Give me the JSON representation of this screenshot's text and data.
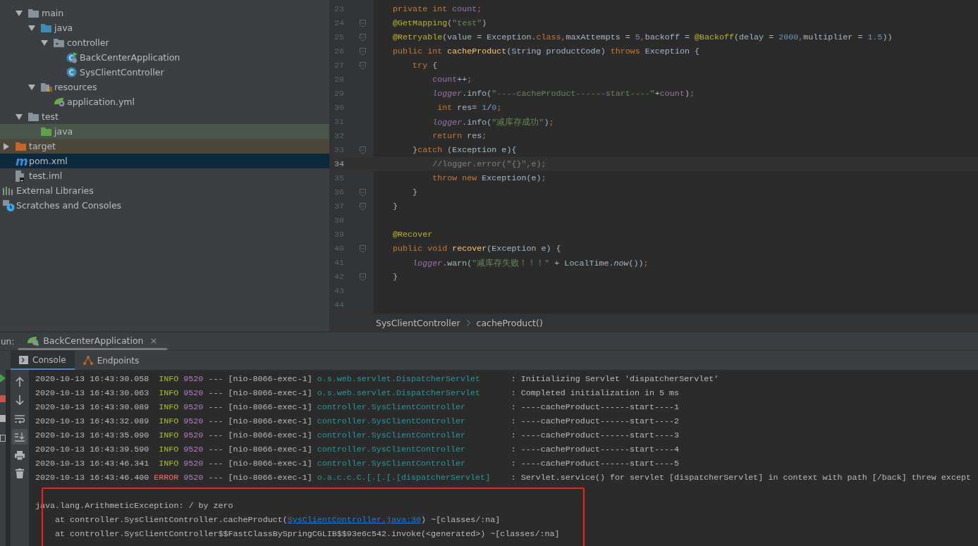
{
  "project": {
    "tree": [
      {
        "name": "main",
        "kind": "folder",
        "expanded": true,
        "selected": false,
        "children": [
          {
            "name": "java",
            "kind": "source-folder",
            "expanded": true,
            "selected": false,
            "children": [
              {
                "name": "controller",
                "kind": "package",
                "expanded": true,
                "selected": false,
                "children": [
                  {
                    "name": "BackCenterApplication",
                    "kind": "spring-class",
                    "selected": false
                  },
                  {
                    "name": "SysClientController",
                    "kind": "class",
                    "selected": false
                  }
                ]
              }
            ]
          },
          {
            "name": "resources",
            "kind": "resources-folder",
            "expanded": true,
            "selected": false,
            "children": [
              {
                "name": "application.yml",
                "kind": "spring-config",
                "selected": false
              }
            ]
          }
        ]
      },
      {
        "name": "test",
        "kind": "folder",
        "expanded": true,
        "selected": false,
        "children": [
          {
            "name": "java",
            "kind": "test-folder",
            "selected": false,
            "color": "#49544a"
          }
        ]
      }
    ],
    "root_items": [
      {
        "name": "target",
        "kind": "excluded-folder",
        "expanded": false,
        "selected": false,
        "color": "#4b473b"
      },
      {
        "name": "pom.xml",
        "kind": "maven",
        "icon_text": "m",
        "selected": true
      },
      {
        "name": "test.iml",
        "kind": "module-file",
        "selected": false
      }
    ],
    "extra": [
      {
        "name": "External Libraries",
        "kind": "libraries"
      },
      {
        "name": "Scratches and Consoles",
        "kind": "scratches"
      }
    ]
  },
  "editor": {
    "lines": [
      {
        "no": "23",
        "fold": false,
        "current": false,
        "segs": [
          {
            "kind": "kw",
            "text": "    private int "
          },
          {
            "kind": "fld",
            "text": "count"
          },
          {
            "kind": "kw",
            "text": ";"
          }
        ]
      },
      {
        "no": "24",
        "fold": true,
        "current": false,
        "segs": [
          {
            "kind": "ann",
            "text": "    @GetMapping"
          },
          {
            "kind": "txt",
            "text": "("
          },
          {
            "kind": "str",
            "text": "\"test\""
          },
          {
            "kind": "txt",
            "text": ")"
          }
        ]
      },
      {
        "no": "25",
        "fold": true,
        "current": false,
        "segs": [
          {
            "kind": "ann",
            "text": "    @Retryable"
          },
          {
            "kind": "txt",
            "text": "(value = Exception."
          },
          {
            "kind": "kw",
            "text": "class,"
          },
          {
            "kind": "txt",
            "text": "maxAttempts = "
          },
          {
            "kind": "num",
            "text": "5"
          },
          {
            "kind": "kw",
            "text": ","
          },
          {
            "kind": "txt",
            "text": "backoff = "
          },
          {
            "kind": "ann",
            "text": "@Backoff"
          },
          {
            "kind": "txt",
            "text": "(delay = "
          },
          {
            "kind": "num",
            "text": "2000"
          },
          {
            "kind": "kw",
            "text": ","
          },
          {
            "kind": "txt",
            "text": "multiplier = "
          },
          {
            "kind": "num",
            "text": "1.5"
          },
          {
            "kind": "txt",
            "text": "))"
          }
        ]
      },
      {
        "no": "26",
        "fold": true,
        "current": false,
        "segs": [
          {
            "kind": "kw",
            "text": "    public int "
          },
          {
            "kind": "fn",
            "text": "cacheProduct"
          },
          {
            "kind": "txt",
            "text": "(String productCode) "
          },
          {
            "kind": "kw",
            "text": "throws "
          },
          {
            "kind": "txt",
            "text": "Exception {"
          }
        ]
      },
      {
        "no": "27",
        "fold": true,
        "current": false,
        "segs": [
          {
            "kind": "kw",
            "text": "        try "
          },
          {
            "kind": "txt",
            "text": "{"
          }
        ]
      },
      {
        "no": "28",
        "fold": false,
        "current": false,
        "segs": [
          {
            "kind": "fld",
            "text": "            count"
          },
          {
            "kind": "txt",
            "text": "++"
          },
          {
            "kind": "kw",
            "text": ";"
          }
        ]
      },
      {
        "no": "29",
        "fold": false,
        "current": false,
        "segs": [
          {
            "kind": "fldi",
            "text": "            logger"
          },
          {
            "kind": "txt",
            "text": ".info("
          },
          {
            "kind": "str",
            "text": "\"----cacheProduct------start----\""
          },
          {
            "kind": "txt",
            "text": "+"
          },
          {
            "kind": "fld",
            "text": "count"
          },
          {
            "kind": "txt",
            "text": ")"
          },
          {
            "kind": "kw",
            "text": ";"
          }
        ]
      },
      {
        "no": "30",
        "fold": false,
        "current": false,
        "segs": [
          {
            "kind": "kw",
            "text": "             int "
          },
          {
            "kind": "txt",
            "text": "res= "
          },
          {
            "kind": "num",
            "text": "1"
          },
          {
            "kind": "txt",
            "text": "/"
          },
          {
            "kind": "num",
            "text": "0"
          },
          {
            "kind": "kw",
            "text": ";"
          }
        ]
      },
      {
        "no": "31",
        "fold": false,
        "current": false,
        "segs": [
          {
            "kind": "fldi",
            "text": "            logger"
          },
          {
            "kind": "txt",
            "text": ".info("
          },
          {
            "kind": "str",
            "text": "\"减库存成功\""
          },
          {
            "kind": "txt",
            "text": ")"
          },
          {
            "kind": "kw",
            "text": ";"
          }
        ]
      },
      {
        "no": "32",
        "fold": false,
        "current": false,
        "segs": [
          {
            "kind": "kw",
            "text": "            return "
          },
          {
            "kind": "txt",
            "text": "res"
          },
          {
            "kind": "kw",
            "text": ";"
          }
        ]
      },
      {
        "no": "33",
        "fold": true,
        "current": false,
        "segs": [
          {
            "kind": "txt",
            "text": "        }"
          },
          {
            "kind": "kw",
            "text": "catch "
          },
          {
            "kind": "txt",
            "text": "(Exception e){"
          }
        ]
      },
      {
        "no": "34",
        "fold": false,
        "current": true,
        "segs": [
          {
            "kind": "cmt",
            "text": "            //logger.error(\"{}\",e);"
          }
        ]
      },
      {
        "no": "35",
        "fold": false,
        "current": false,
        "segs": [
          {
            "kind": "kw",
            "text": "            throw new "
          },
          {
            "kind": "txt",
            "text": "Exception(e)"
          },
          {
            "kind": "kw",
            "text": ";"
          }
        ]
      },
      {
        "no": "36",
        "fold": true,
        "current": false,
        "segs": [
          {
            "kind": "txt",
            "text": "        }"
          }
        ]
      },
      {
        "no": "37",
        "fold": true,
        "current": false,
        "segs": [
          {
            "kind": "txt",
            "text": "    }"
          }
        ]
      },
      {
        "no": "38",
        "fold": false,
        "current": false
      },
      {
        "no": "39",
        "fold": false,
        "current": false,
        "segs": [
          {
            "kind": "ann",
            "text": "    @Recover"
          }
        ]
      },
      {
        "no": "40",
        "fold": true,
        "current": false,
        "segs": [
          {
            "kind": "kw",
            "text": "    public void "
          },
          {
            "kind": "fn",
            "text": "recover"
          },
          {
            "kind": "txt",
            "text": "(Exception e) {"
          }
        ]
      },
      {
        "no": "41",
        "fold": false,
        "current": false,
        "segs": [
          {
            "kind": "fldi",
            "text": "        logger"
          },
          {
            "kind": "txt",
            "text": ".warn("
          },
          {
            "kind": "str",
            "text": "\"减库存失败！！！\""
          },
          {
            "kind": "txt",
            "text": " + LocalTime."
          },
          {
            "kind": "stat",
            "text": "now"
          },
          {
            "kind": "txt",
            "text": "())"
          },
          {
            "kind": "kw",
            "text": ";"
          }
        ]
      },
      {
        "no": "42",
        "fold": true,
        "current": false,
        "segs": [
          {
            "kind": "txt",
            "text": "    }"
          }
        ]
      },
      {
        "no": "43",
        "fold": false,
        "current": false
      },
      {
        "no": "44",
        "fold": false,
        "current": false
      }
    ],
    "breadcrumb": [
      "SysClientController",
      "cacheProduct()"
    ]
  },
  "run": {
    "label": "un:",
    "tab": "BackCenterApplication",
    "close": "×",
    "tabs": [
      {
        "label": "Console",
        "kind": "console",
        "selected": true
      },
      {
        "label": "Endpoints",
        "kind": "endpoints",
        "selected": false
      }
    ],
    "tools": [
      {
        "kind": "up",
        "on": false
      },
      {
        "kind": "down",
        "on": false
      },
      {
        "kind": "wrap",
        "on": false
      },
      {
        "kind": "scroll-end",
        "on": true
      },
      {
        "kind": "print",
        "on": false
      },
      {
        "kind": "trash",
        "on": false
      }
    ],
    "log": [
      {
        "ts": "2020-10-13 16:43:30.058",
        "level": "INFO",
        "kind": "info",
        "pid": "9520",
        "sep": "---",
        "thread": "[nio-8066-exec-1]",
        "logger": "o.s.web.servlet.DispatcherServlet",
        "msg": ": Initializing Servlet 'dispatcherServlet'"
      },
      {
        "ts": "2020-10-13 16:43:30.063",
        "level": "INFO",
        "kind": "info",
        "pid": "9520",
        "sep": "---",
        "thread": "[nio-8066-exec-1]",
        "logger": "o.s.web.servlet.DispatcherServlet",
        "msg": ": Completed initialization in 5 ms"
      },
      {
        "ts": "2020-10-13 16:43:30.089",
        "level": "INFO",
        "kind": "info",
        "pid": "9520",
        "sep": "---",
        "thread": "[nio-8066-exec-1]",
        "logger": "controller.SysClientController",
        "msg": ": ----cacheProduct------start----1"
      },
      {
        "ts": "2020-10-13 16:43:32.089",
        "level": "INFO",
        "kind": "info",
        "pid": "9520",
        "sep": "---",
        "thread": "[nio-8066-exec-1]",
        "logger": "controller.SysClientController",
        "msg": ": ----cacheProduct------start----2"
      },
      {
        "ts": "2020-10-13 16:43:35.090",
        "level": "INFO",
        "kind": "info",
        "pid": "9520",
        "sep": "---",
        "thread": "[nio-8066-exec-1]",
        "logger": "controller.SysClientController",
        "msg": ": ----cacheProduct------start----3"
      },
      {
        "ts": "2020-10-13 16:43:39.590",
        "level": "INFO",
        "kind": "info",
        "pid": "9520",
        "sep": "---",
        "thread": "[nio-8066-exec-1]",
        "logger": "controller.SysClientController",
        "msg": ": ----cacheProduct------start----4"
      },
      {
        "ts": "2020-10-13 16:43:46.341",
        "level": "INFO",
        "kind": "info",
        "pid": "9520",
        "sep": "---",
        "thread": "[nio-8066-exec-1]",
        "logger": "controller.SysClientController",
        "msg": ": ----cacheProduct------start----5"
      },
      {
        "ts": "2020-10-13 16:43:46.400",
        "level": "ERROR",
        "kind": "error",
        "pid": "9520",
        "sep": "---",
        "thread": "[nio-8066-exec-1]",
        "logger": "o.a.c.c.C.[.[.[.[dispatcherServlet]",
        "msg": ": Servlet.service() for servlet [dispatcherServlet] in context with path [/back] threw except"
      }
    ],
    "trace": [
      {
        "text": "java.lang.ArithmeticException: / by zero"
      },
      {
        "text": "    at controller.SysClientController.cacheProduct(",
        "link": "SysClientController.java:30",
        "after": ") ~[classes/:na]"
      },
      {
        "text": "    at controller.SysClientController$$FastClassBySpringCGLIB$$93e6c542.invoke(<generated>) ~[classes/:na]"
      }
    ]
  }
}
